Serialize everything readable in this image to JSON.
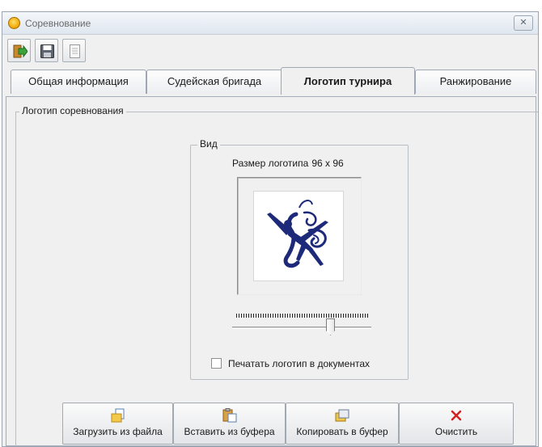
{
  "window": {
    "title": "Соревнование",
    "close_symbol": "✕"
  },
  "toolbar": {
    "buttons": [
      {
        "name": "exit-icon"
      },
      {
        "name": "save-icon"
      },
      {
        "name": "document-icon"
      }
    ]
  },
  "tabs": [
    {
      "label": "Общая информация",
      "active": false
    },
    {
      "label": "Судейская бригада",
      "active": false
    },
    {
      "label": "Логотип турнира",
      "active": true
    },
    {
      "label": "Ранжирование",
      "active": false
    }
  ],
  "logo_group": {
    "legend": "Логотип соревнования",
    "view": {
      "legend": "Вид",
      "size_label": "Размер логотипа",
      "size_value": "96 x 96",
      "slider_level": 0.72
    },
    "print_checkbox": {
      "label": "Печатать логотип в документах",
      "checked": false
    }
  },
  "actions": [
    {
      "label": "Загрузить из файла",
      "icon": "load-file-icon"
    },
    {
      "label": "Вставить из буфера",
      "icon": "paste-icon"
    },
    {
      "label": "Копировать в буфер",
      "icon": "copy-icon"
    },
    {
      "label": "Очистить",
      "icon": "clear-x-icon",
      "color": "#d42020"
    }
  ]
}
